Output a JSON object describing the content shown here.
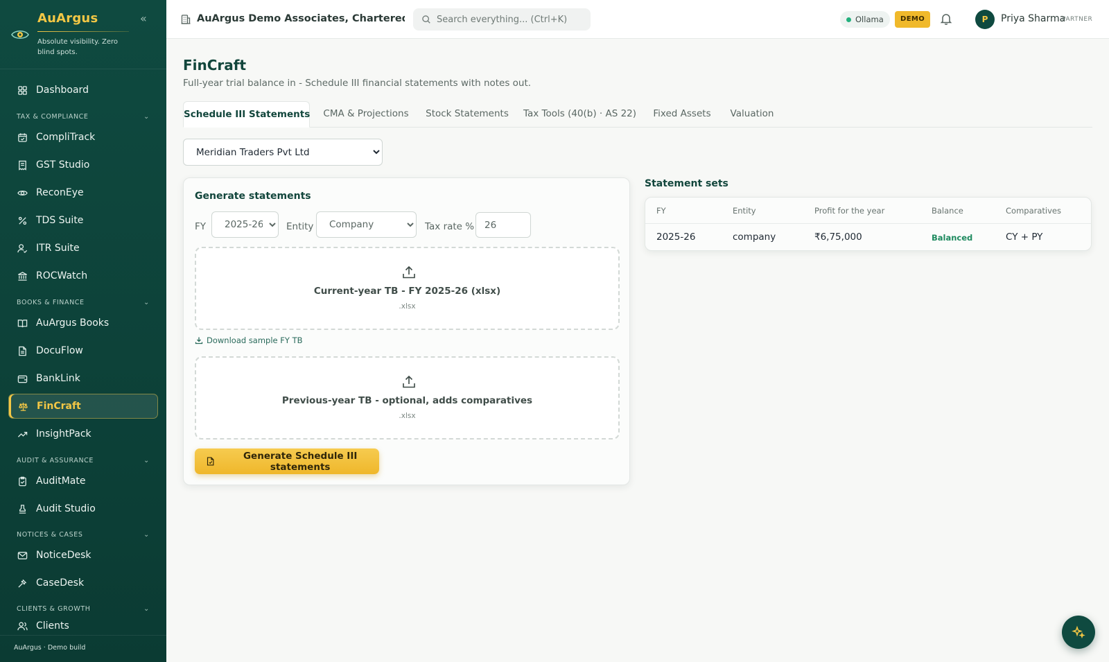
{
  "brand": {
    "name": "AuArgus",
    "tagline": "Absolute visibility. Zero blind spots.",
    "footer": "AuArgus · Demo build"
  },
  "sidebar": {
    "items": [
      {
        "label": "Dashboard",
        "icon": "grid-icon"
      },
      {
        "section": "TAX & COMPLIANCE"
      },
      {
        "label": "CompliTrack",
        "icon": "calendar-check-icon"
      },
      {
        "label": "GST Studio",
        "icon": "receipt-icon"
      },
      {
        "label": "ReconEye",
        "icon": "eye-icon"
      },
      {
        "label": "TDS Suite",
        "icon": "percent-icon"
      },
      {
        "label": "ITR Suite",
        "icon": "user-check-icon"
      },
      {
        "label": "ROCWatch",
        "icon": "landmark-icon"
      },
      {
        "section": "BOOKS & FINANCE"
      },
      {
        "label": "AuArgus Books",
        "icon": "book-open-icon"
      },
      {
        "label": "DocuFlow",
        "icon": "file-text-icon"
      },
      {
        "label": "BankLink",
        "icon": "wallet-icon"
      },
      {
        "label": "FinCraft",
        "icon": "scale-icon",
        "active": true
      },
      {
        "label": "InsightPack",
        "icon": "trending-up-icon"
      },
      {
        "section": "AUDIT & ASSURANCE"
      },
      {
        "label": "AuditMate",
        "icon": "clipboard-check-icon"
      },
      {
        "label": "Audit Studio",
        "icon": "stamp-icon"
      },
      {
        "section": "NOTICES & CASES"
      },
      {
        "label": "NoticeDesk",
        "icon": "mail-icon"
      },
      {
        "label": "CaseDesk",
        "icon": "gavel-icon"
      },
      {
        "section": "CLIENTS & GROWTH"
      },
      {
        "label": "Clients",
        "icon": "users-icon"
      }
    ]
  },
  "topbar": {
    "org_name": "AuArgus Demo Associates, Chartered Accou...",
    "search_placeholder": "Search everything... (Ctrl+K)",
    "ollama_label": "Ollama",
    "ollama_status_color": "#22b07d",
    "demo_badge": "DEMO",
    "user_initial": "P",
    "user_name": "Priya Sharma",
    "user_role": "PARTNER"
  },
  "page": {
    "title": "FinCraft",
    "subtitle": "Full-year trial balance in - Schedule III financial statements with notes out."
  },
  "tabs": [
    {
      "label": "Schedule III Statements",
      "active": true
    },
    {
      "label": "CMA & Projections"
    },
    {
      "label": "Stock Statements"
    },
    {
      "label": "Tax Tools (40(b) · AS 22)"
    },
    {
      "label": "Fixed Assets"
    },
    {
      "label": "Valuation"
    }
  ],
  "client_select": {
    "value": "Meridian Traders Pvt Ltd",
    "options": [
      "Meridian Traders Pvt Ltd"
    ]
  },
  "generate": {
    "title": "Generate statements",
    "fy_label": "FY",
    "fy_value": "2025-26",
    "entity_label": "Entity",
    "entity_value": "Company",
    "tax_label": "Tax rate %",
    "tax_value": "26",
    "current_tb_label": "Current-year TB - FY 2025-26 (xlsx)",
    "current_tb_ext": ".xlsx",
    "download_sample": "Download sample FY TB",
    "previous_tb_label": "Previous-year TB - optional, adds comparatives",
    "previous_tb_ext": ".xlsx",
    "button_label": "Generate Schedule III statements"
  },
  "statement_sets": {
    "title": "Statement sets",
    "columns": [
      "FY",
      "Entity",
      "Profit for the year",
      "Balance",
      "Comparatives"
    ],
    "rows": [
      {
        "fy": "2025-26",
        "entity": "company",
        "profit": "₹6,75,000",
        "balance": "Balanced",
        "comparatives": "CY + PY"
      }
    ]
  },
  "colors": {
    "sidebar_bg": "#0f4a40",
    "accent_gold": "#f3c745",
    "primary_text": "#12463c",
    "balanced_green": "#1e8a5f"
  }
}
